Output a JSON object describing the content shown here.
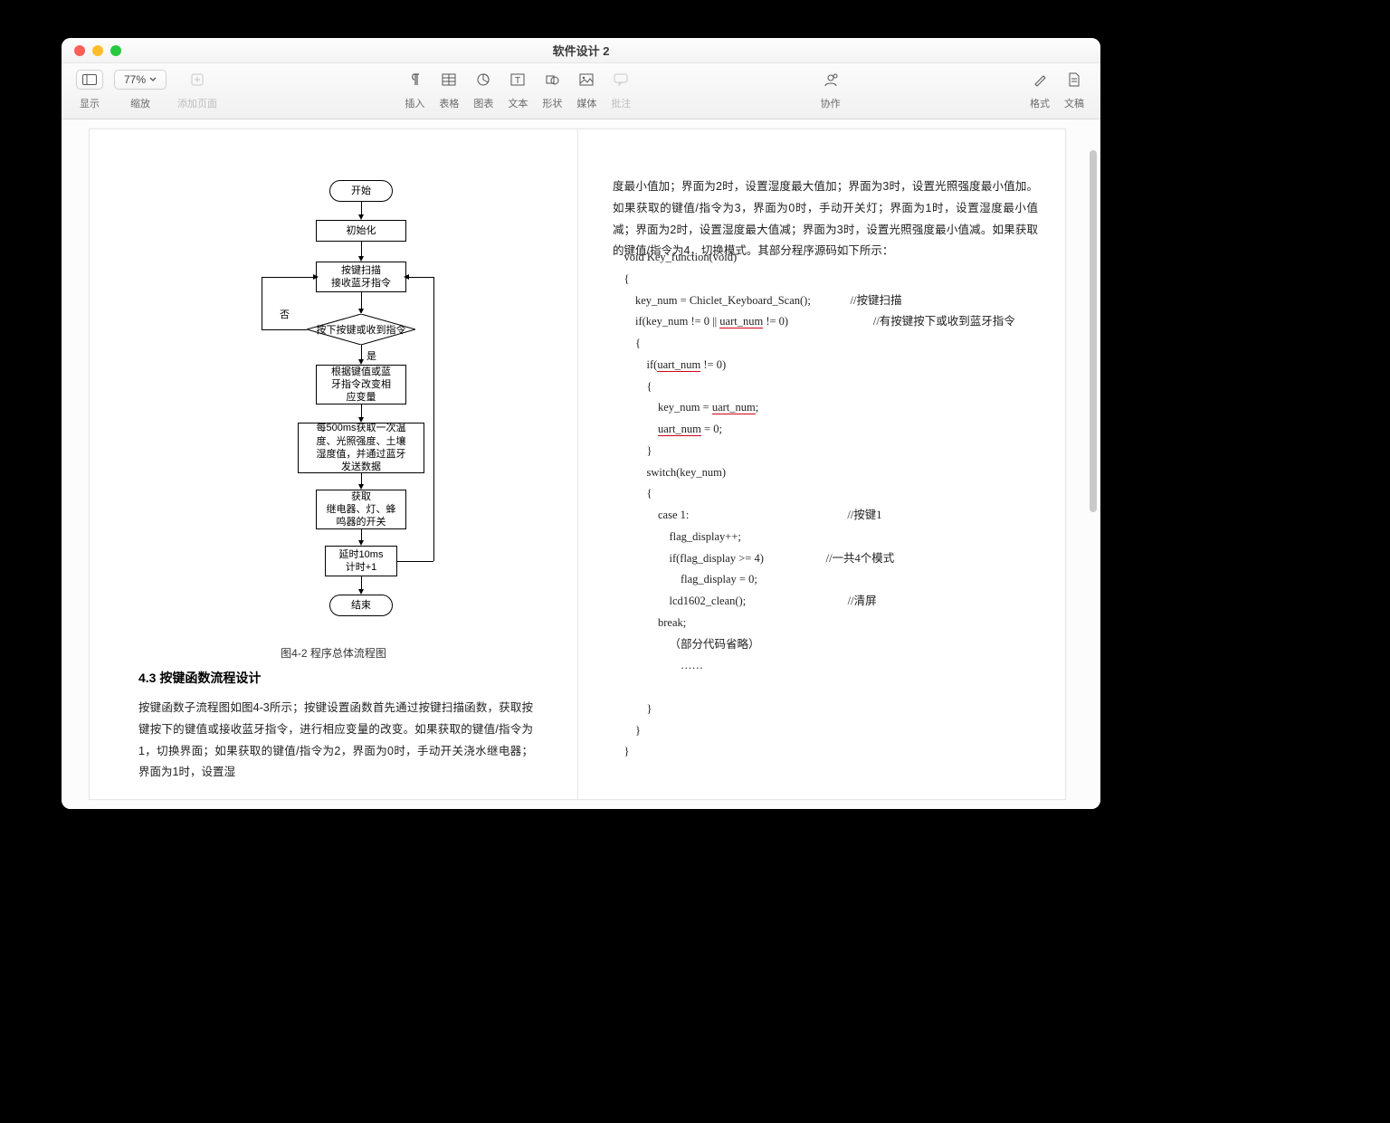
{
  "window": {
    "title": "软件设计 2"
  },
  "toolbar": {
    "view_label": "显示",
    "zoom_label": "缩放",
    "zoom_value": "77%",
    "add_page_label": "添加页面",
    "insert_label": "插入",
    "table_label": "表格",
    "chart_label": "图表",
    "text_label": "文本",
    "shape_label": "形状",
    "media_label": "媒体",
    "comment_label": "批注",
    "collab_label": "协作",
    "format_label": "格式",
    "document_label": "文稿"
  },
  "left_page": {
    "flow": {
      "b0": "开始",
      "b1": "初始化",
      "b2": "按键扫描\n接收蓝牙指令",
      "d_no": "否",
      "d_text": "按下按键或收到指令",
      "d_yes": "是",
      "b3": "根据键值或蓝\n牙指令改变相\n应变量",
      "b4": "每500ms获取一次温\n度、光照强度、土壤\n湿度值，并通过蓝牙\n发送数据",
      "b5": "获取\n继电器、灯、蜂\n鸣器的开关",
      "b6": "延时10ms\n计时+1",
      "b7": "结束"
    },
    "caption": "图4-2   程序总体流程图",
    "section_title": "4.3 按键函数流程设计",
    "para1": "        按键函数子流程图如图4-3所示；按键设置函数首先通过按键扫描函数，获取按键按下的键值或接收蓝牙指令，进行相应变量的改变。如果获取的键值/指令为1，切换界面；如果获取的键值/指令为2，界面为0时，手动开关浇水继电器；界面为1时，设置湿"
  },
  "right_page": {
    "para1": "度最小值加；界面为2时，设置湿度最大值加；界面为3时，设置光照强度最小值加。如果获取的键值/指令为3，界面为0时，手动开关灯；界面为1时，设置湿度最小值减；界面为2时，设置湿度最大值减；界面为3时，设置光照强度最小值减。如果获取的键值/指令为4，切换模式。其部分程序源码如下所示：",
    "code": {
      "l1": "void Key_function(void)",
      "l2": "{",
      "l3a": "key_num = Chiclet_Keyboard_Scan();",
      "l3b": "//按键扫描",
      "l4a": "if(key_num != 0 || ",
      "l4u": "uart_num",
      "l4c": " != 0)",
      "l4b": "//有按键按下或收到蓝牙指令",
      "l5": "{",
      "l6a": "if(",
      "l6u": "uart_num",
      "l6c": " != 0)",
      "l7": "{",
      "l8a": "key_num = ",
      "l8u": "uart_num",
      "l8c": ";",
      "l9u": "uart_num",
      "l9c": " = 0;",
      "l10": "}",
      "l11": "switch(key_num)",
      "l12": "{",
      "l13a": "case 1:",
      "l13b": "//按键1",
      "l14": "flag_display++;",
      "l15a": "if(flag_display >= 4)",
      "l15b": "//一共4个模式",
      "l16": "flag_display = 0;",
      "l17a": "lcd1602_clean();",
      "l17b": "//清屏",
      "l18": "break;",
      "l19": "（部分代码省略）",
      "l20": "……",
      "l21": "}",
      "l22": "}",
      "l23": "}"
    }
  }
}
